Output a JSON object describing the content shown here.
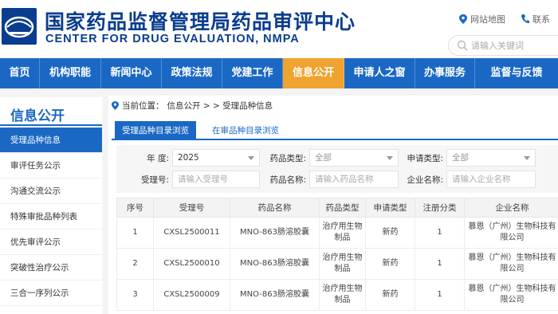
{
  "header": {
    "title_cn": "国家药品监督管理局药品审评中心",
    "title_en": "CENTER FOR DRUG EVALUATION, NMPA",
    "sitemap_label": "网站地图",
    "contact_label": "联系",
    "search_placeholder": "请输入关键词",
    "brand_color": "#0a3d8f"
  },
  "nav": {
    "items": [
      "首页",
      "机构职能",
      "新闻中心",
      "政策法规",
      "党建工作",
      "信息公开",
      "申请人之窗",
      "办事服务",
      "监督与反馈"
    ],
    "active_index": 5,
    "bg_color": "#1a68c4",
    "active_color": "#f0a32f"
  },
  "sidebar": {
    "title": "信息公开",
    "items": [
      "受理品种信息",
      "审评任务公示",
      "沟通交流公示",
      "特殊审批品种列表",
      "优先审评公示",
      "突破性治疗公示",
      "三合一序列公示"
    ],
    "active_index": 0
  },
  "breadcrumb": {
    "prefix": "当前位置：",
    "path": "信息公开 > > 受理品种信息"
  },
  "tabs": [
    "受理品种目录浏览",
    "在审品种目录浏览"
  ],
  "filters": {
    "year_label": "年  度:",
    "year_value": "2025",
    "drug_type_label": "药品类型:",
    "drug_type_value": "全部",
    "apply_type_label": "申请类型:",
    "apply_type_value": "全部",
    "accept_no_label": "受理号:",
    "accept_no_placeholder": "请输入受理号",
    "drug_name_label": "药品名称:",
    "drug_name_placeholder": "请输入药品名称",
    "company_label": "企业名称:",
    "company_placeholder": "请输入企业名称"
  },
  "table": {
    "headers": [
      "序号",
      "受理号",
      "药品名称",
      "药品类型",
      "申请类型",
      "注册分类",
      "企业名称"
    ],
    "rows": [
      [
        "1",
        "CXSL2500011",
        "MNO-863肠溶胶囊",
        "治疗用生物制品",
        "新药",
        "1",
        "慕恩（广州）生物科技有限公司"
      ],
      [
        "2",
        "CXSL2500010",
        "MNO-863肠溶胶囊",
        "治疗用生物制品",
        "新药",
        "1",
        "慕恩（广州）生物科技有限公司"
      ],
      [
        "3",
        "CXSL2500009",
        "MNO-863肠溶胶囊",
        "治疗用生物制品",
        "新药",
        "1",
        "慕恩（广州）生物科技有限公司"
      ]
    ]
  }
}
